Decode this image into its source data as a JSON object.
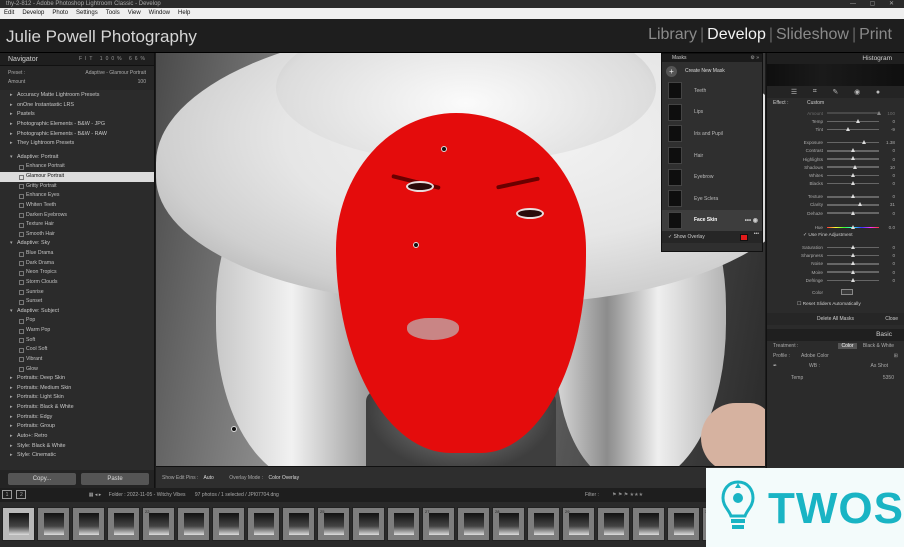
{
  "window": {
    "title": "thy-2-812 - Adobe Photoshop Lightroom Classic - Develop",
    "controls": [
      "—",
      "▢",
      "✕"
    ]
  },
  "menu": [
    "Edit",
    "Develop",
    "Photo",
    "Settings",
    "Tools",
    "View",
    "Window",
    "Help"
  ],
  "identity_plate": "Julie Powell Photography",
  "modules": [
    {
      "label": "Library",
      "active": false
    },
    {
      "label": "Develop",
      "active": true
    },
    {
      "label": "Slideshow",
      "active": false
    },
    {
      "label": "Print",
      "active": false
    }
  ],
  "navigator": {
    "title": "Navigator",
    "zoom": [
      "FIT",
      "100%",
      "66%"
    ]
  },
  "preset_info": {
    "preset_label": "Preset :",
    "preset_value": "Adaptive - Glamour Portrait",
    "amount_label": "Amount",
    "amount_value": "100",
    "amount_level": 1.0
  },
  "presets": [
    {
      "type": "group",
      "label": "Accuracy Matte Lightroom Presets"
    },
    {
      "type": "group",
      "label": "onOne Instantastic LRS"
    },
    {
      "type": "group",
      "label": "Pastels"
    },
    {
      "type": "group",
      "label": "Photographic Elements - B&W - JPG"
    },
    {
      "type": "group",
      "label": "Photographic Elements - B&W - RAW"
    },
    {
      "type": "group",
      "label": "They Lightroom Presets"
    },
    {
      "type": "spacer",
      "label": ""
    },
    {
      "type": "group",
      "label": "Adaptive: Portrait",
      "open": true
    },
    {
      "type": "item",
      "label": "Enhance Portrait"
    },
    {
      "type": "item",
      "label": "Glamour Portrait",
      "selected": true
    },
    {
      "type": "item",
      "label": "Gritty Portrait"
    },
    {
      "type": "item",
      "label": "Enhance Eyes"
    },
    {
      "type": "item",
      "label": "Whiten Teeth"
    },
    {
      "type": "item",
      "label": "Darken Eyebrows"
    },
    {
      "type": "item",
      "label": "Texture Hair"
    },
    {
      "type": "item",
      "label": "Smooth Hair"
    },
    {
      "type": "group",
      "label": "Adaptive: Sky",
      "open": true
    },
    {
      "type": "item",
      "label": "Blue Drama"
    },
    {
      "type": "item",
      "label": "Dark Drama"
    },
    {
      "type": "item",
      "label": "Neon Tropics"
    },
    {
      "type": "item",
      "label": "Storm Clouds"
    },
    {
      "type": "item",
      "label": "Sunrise"
    },
    {
      "type": "item",
      "label": "Sunset"
    },
    {
      "type": "group",
      "label": "Adaptive: Subject",
      "open": true
    },
    {
      "type": "item",
      "label": "Pop"
    },
    {
      "type": "item",
      "label": "Warm Pop"
    },
    {
      "type": "item",
      "label": "Soft"
    },
    {
      "type": "item",
      "label": "Cool Soft"
    },
    {
      "type": "item",
      "label": "Vibrant"
    },
    {
      "type": "item",
      "label": "Glow"
    },
    {
      "type": "group",
      "label": "Portraits: Deep Skin"
    },
    {
      "type": "group",
      "label": "Portraits: Medium Skin"
    },
    {
      "type": "group",
      "label": "Portraits: Light Skin"
    },
    {
      "type": "group",
      "label": "Portraits: Black & White"
    },
    {
      "type": "group",
      "label": "Portraits: Edgy"
    },
    {
      "type": "group",
      "label": "Portraits: Group"
    },
    {
      "type": "group",
      "label": "Auto+: Retro"
    },
    {
      "type": "group",
      "label": "Style: Black & White"
    },
    {
      "type": "group",
      "label": "Style: Cinematic"
    }
  ],
  "left_buttons": {
    "copy": "Copy...",
    "paste": "Paste"
  },
  "masks": {
    "title": "Masks",
    "create": "Create New Mask",
    "items": [
      {
        "label": "Teeth",
        "active": false
      },
      {
        "label": "Lips",
        "active": false
      },
      {
        "label": "Iris and Pupil",
        "active": false
      },
      {
        "label": "Hair",
        "active": false
      },
      {
        "label": "Eyebrow",
        "active": false
      },
      {
        "label": "Eye Sclera",
        "active": false
      },
      {
        "label": "Face Skin",
        "active": true
      }
    ],
    "show_overlay": "Show Overlay",
    "overlay_color": "#e21b1b"
  },
  "right": {
    "histogram_title": "Histogram",
    "effect_label": "Effect :",
    "effect_value": "Custom",
    "sliders_top": [
      {
        "label": "Amount",
        "value": "100",
        "level": 1.0,
        "dim": true
      },
      {
        "label": "Temp",
        "value": "0",
        "level": 0.6
      },
      {
        "label": "Tint",
        "value": "-9",
        "level": 0.42
      }
    ],
    "sliders_tone": [
      {
        "label": "Exposure",
        "value": "1.38",
        "level": 0.72
      },
      {
        "label": "Contrast",
        "value": "0",
        "level": 0.5
      },
      {
        "label": "Highlights",
        "value": "0",
        "level": 0.5
      },
      {
        "label": "Shadows",
        "value": "10",
        "level": 0.55
      },
      {
        "label": "Whites",
        "value": "0",
        "level": 0.5
      },
      {
        "label": "Blacks",
        "value": "0",
        "level": 0.5
      }
    ],
    "sliders_presence": [
      {
        "label": "Texture",
        "value": "0",
        "level": 0.5
      },
      {
        "label": "Clarity",
        "value": "31",
        "level": 0.65
      },
      {
        "label": "Dehaze",
        "value": "0",
        "level": 0.5
      }
    ],
    "hue": {
      "label": "Hue",
      "value": "0.0",
      "level": 0.5
    },
    "fine_adjust": "Use Fine Adjustment",
    "sliders_color": [
      {
        "label": "Saturation",
        "value": "0",
        "level": 0.5
      },
      {
        "label": "Sharpness",
        "value": "0",
        "level": 0.5
      },
      {
        "label": "Noise",
        "value": "0",
        "level": 0.5
      },
      {
        "label": "Moire",
        "value": "0",
        "level": 0.5
      },
      {
        "label": "Defringe",
        "value": "0",
        "level": 0.5
      }
    ],
    "color_label": "Color",
    "reset_label": "Reset Sliders Automatically",
    "delete_all": "Delete All Masks",
    "close": "Close",
    "basic_title": "Basic",
    "treatment_label": "Treatment :",
    "treatment_options": [
      "Color",
      "Black & White"
    ],
    "profile_label": "Profile :",
    "profile_value": "Adobe Color",
    "wb_label": "WB :",
    "wb_value": "As Shot",
    "temp_label": "Temp",
    "temp_value": "5350"
  },
  "toolbar": {
    "pins_label": "Show Edit Pins :",
    "pins_value": "Auto",
    "overlay_label": "Overlay Mode :",
    "overlay_value": "Color Overlay"
  },
  "filmbar": {
    "screens": [
      "1",
      "2"
    ],
    "folder": "Folder : 2022-11-05 - Witchy Vibes",
    "count": "97 photos / 1 selected / JPI07704.dng",
    "filter": "Filter :"
  },
  "filmstrip_numbers": [
    "",
    "",
    "",
    "",
    "22",
    "",
    "",
    "",
    "",
    "25",
    "",
    "",
    "27",
    "",
    "28",
    "",
    "29",
    "",
    "",
    "",
    "30",
    "",
    "",
    "",
    "",
    "",
    "",
    ""
  ],
  "watermark": {
    "text": "TWOS"
  },
  "colors": {
    "mask_red": "#e40c0c",
    "accent": "#19b4c4"
  }
}
